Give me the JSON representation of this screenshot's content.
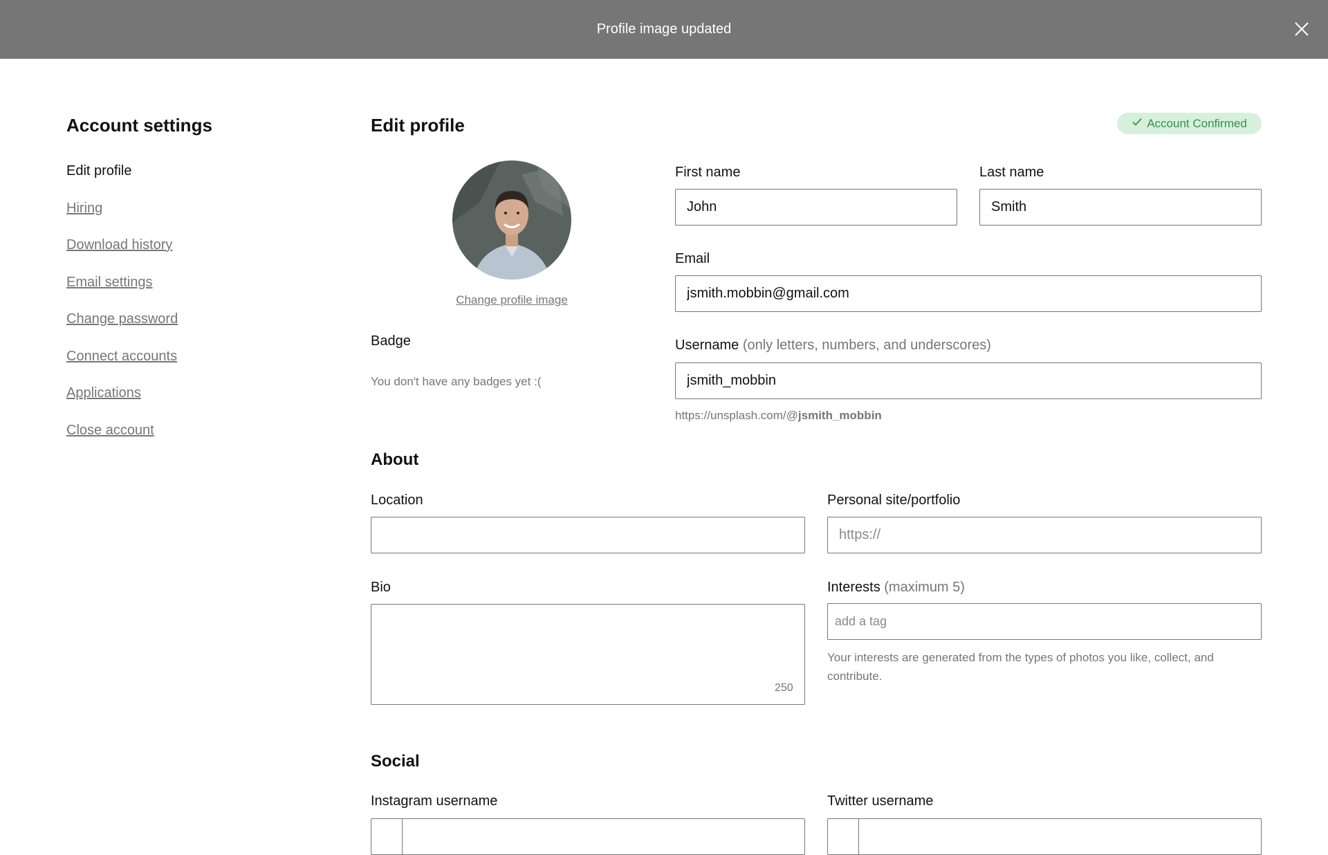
{
  "banner": {
    "message": "Profile image updated"
  },
  "sidebar": {
    "title": "Account settings",
    "items": [
      {
        "label": "Edit profile"
      },
      {
        "label": "Hiring"
      },
      {
        "label": "Download history"
      },
      {
        "label": "Email settings"
      },
      {
        "label": "Change password"
      },
      {
        "label": "Connect accounts"
      },
      {
        "label": "Applications"
      },
      {
        "label": "Close account"
      }
    ]
  },
  "main": {
    "title": "Edit profile",
    "account_badge": "Account Confirmed",
    "change_image_label": "Change profile image",
    "badge_label": "Badge",
    "badge_empty": "You don't have any badges yet :(",
    "first_name": {
      "label": "First name",
      "value": "John"
    },
    "last_name": {
      "label": "Last name",
      "value": "Smith"
    },
    "email": {
      "label": "Email",
      "value": "jsmith.mobbin@gmail.com"
    },
    "username": {
      "label": "Username",
      "hint": "(only letters, numbers, and underscores)",
      "value": "jsmith_mobbin",
      "url_prefix": "https://unsplash.com/@",
      "url_user": "jsmith_mobbin"
    },
    "about": {
      "title": "About",
      "location": {
        "label": "Location",
        "value": ""
      },
      "personal_site": {
        "label": "Personal site/portfolio",
        "placeholder": "https://"
      },
      "bio": {
        "label": "Bio",
        "value": "",
        "char_count": "250"
      },
      "interests": {
        "label": "Interests",
        "hint": "(maximum 5)",
        "placeholder": "add a tag",
        "help": "Your interests are generated from the types of photos you like, collect, and contribute."
      }
    },
    "social": {
      "title": "Social",
      "instagram": {
        "label": "Instagram username"
      },
      "twitter": {
        "label": "Twitter username"
      }
    }
  },
  "colors": {
    "banner_bg": "#767676",
    "badge_bg": "#d7f0dc",
    "badge_text": "#3a8c51",
    "muted_text": "#767676"
  },
  "icons": {
    "close": "close-icon",
    "check": "check-icon"
  }
}
